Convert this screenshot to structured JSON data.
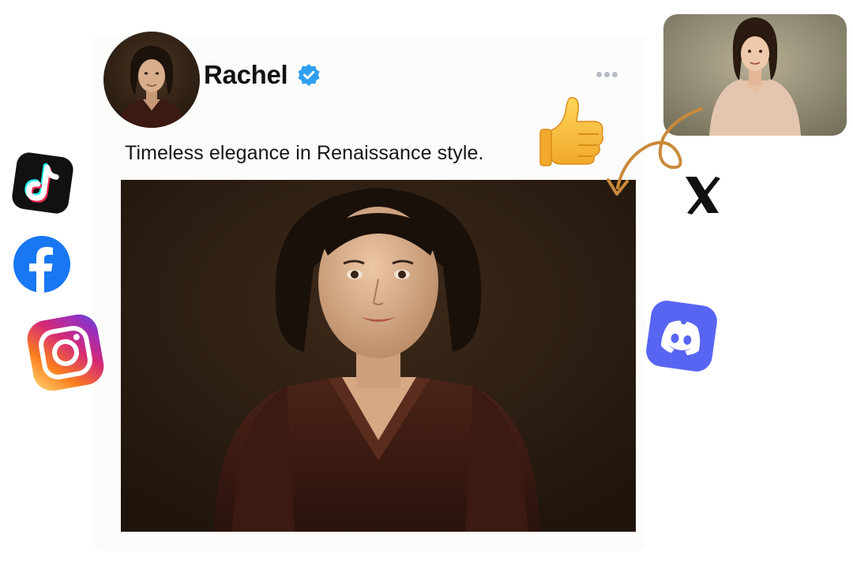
{
  "post": {
    "username": "Rachel",
    "caption": "Timeless elegance in Renaissance style."
  },
  "icons": {
    "verified": "verified-badge-icon",
    "more": "more-options-icon",
    "thumbs_up": "thumbs-up-icon",
    "arrow": "curved-arrow-icon"
  },
  "social_icons": [
    "tiktok-icon",
    "facebook-icon",
    "instagram-icon",
    "discord-icon",
    "x-icon"
  ],
  "colors": {
    "verified_blue": "#2f9ff2",
    "facebook_blue": "#1877f2",
    "discord_blurple": "#5865f2",
    "arrow_orange": "#c98a3a",
    "painting_bg": "#2e1e12"
  }
}
